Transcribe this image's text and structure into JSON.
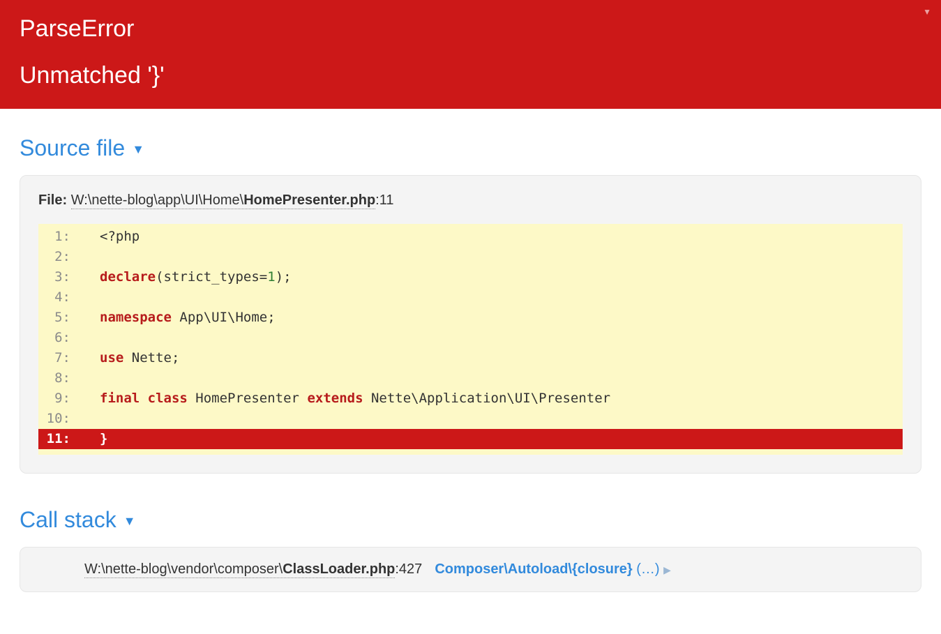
{
  "header": {
    "error_type": "ParseError",
    "error_message": "Unmatched '}'"
  },
  "source": {
    "title": "Source file",
    "file_label": "File:",
    "path_prefix": "W:\\nette-blog\\app\\UI\\Home\\",
    "file_name": "HomePresenter.php",
    "line_no": ":11",
    "lines": {
      "l1": {
        "num": "1"
      },
      "l2": {
        "num": "2"
      },
      "l3": {
        "num": "3"
      },
      "l4": {
        "num": "4"
      },
      "l5": {
        "num": "5"
      },
      "l6": {
        "num": "6"
      },
      "l7": {
        "num": "7"
      },
      "l8": {
        "num": "8"
      },
      "l9": {
        "num": "9"
      },
      "l10": {
        "num": "10"
      },
      "l11": {
        "num": "11",
        "code": "}"
      }
    },
    "tokens": {
      "php_open": "<?php",
      "declare_kw": "declare",
      "declare_open": "(",
      "strict_types": "strict_types=",
      "one": "1",
      "declare_close": ");",
      "namespace_kw": "namespace",
      "namespace_val": " App\\UI\\Home;",
      "use_kw": "use",
      "use_val": " Nette;",
      "final_kw": "final",
      "class_kw": " class",
      "class_name": " HomePresenter ",
      "extends_kw": "extends",
      "extends_val": " Nette\\Application\\UI\\Presenter"
    }
  },
  "callstack": {
    "title": "Call stack",
    "row1": {
      "path_prefix": "W:\\nette-blog\\vendor\\composer\\",
      "file_name": "ClassLoader.php",
      "line_no": ":427",
      "fn": "Composer\\Autoload\\{closure}",
      "args": " (…)"
    }
  }
}
